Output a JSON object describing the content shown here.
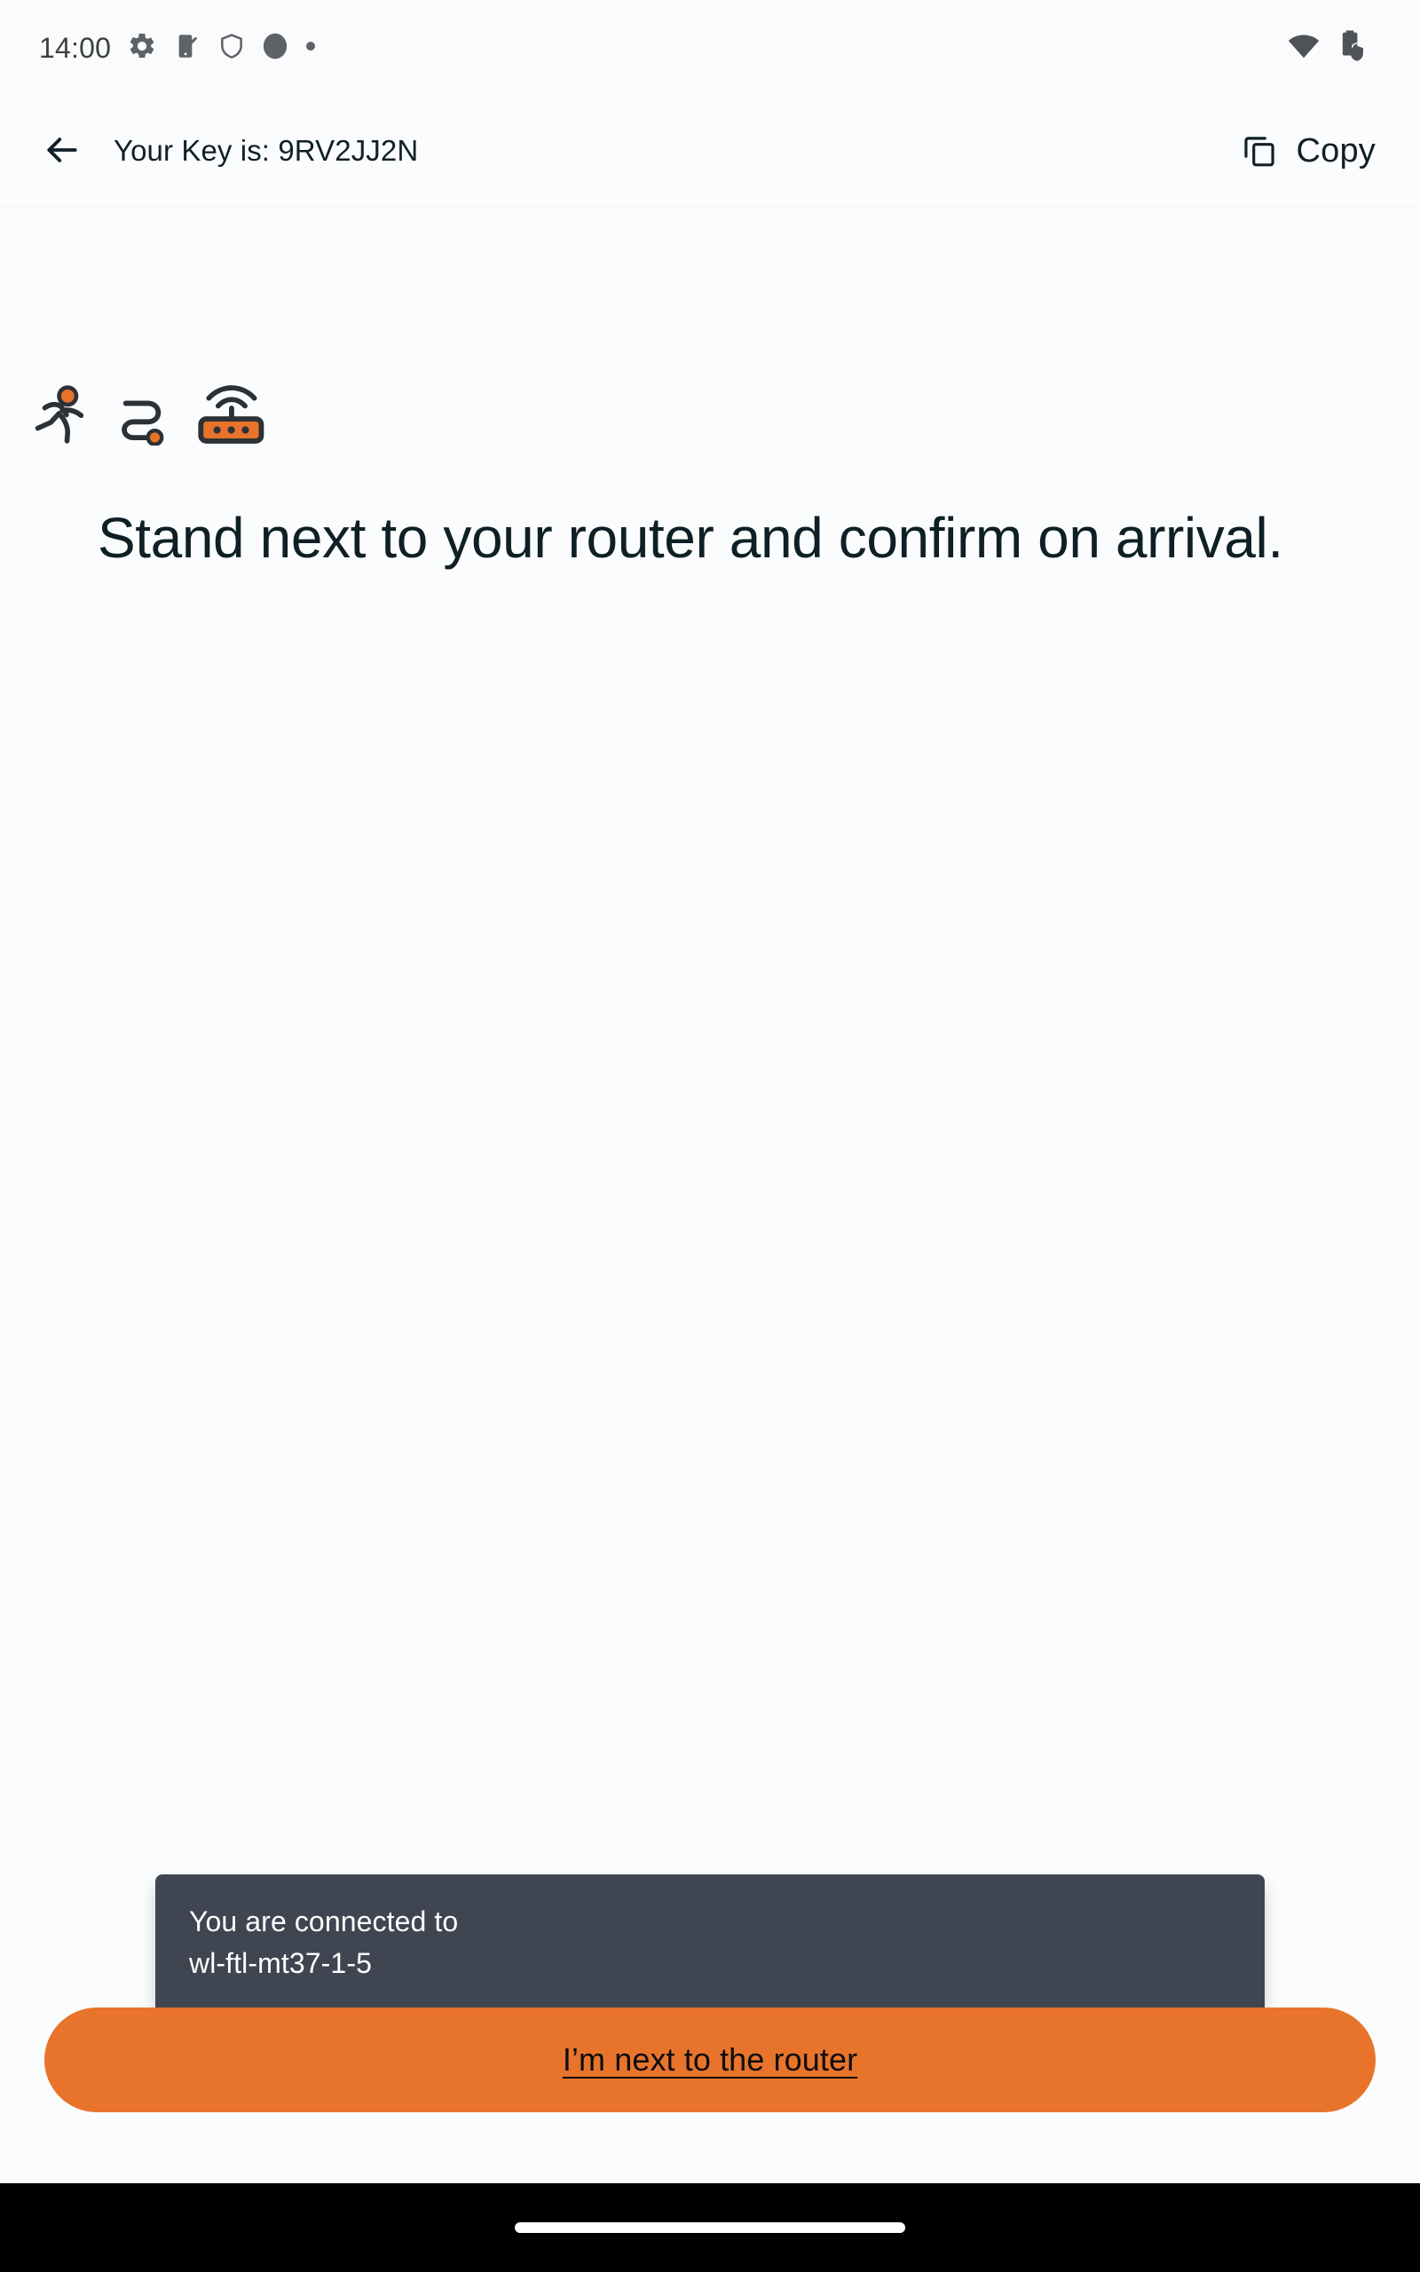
{
  "status_bar": {
    "time": "14:00",
    "left_icons": [
      "gear-icon",
      "phone-check-icon",
      "shield-icon",
      "circle-icon",
      "dot-icon"
    ],
    "right_icons": [
      "wifi-icon",
      "battery-shield-icon"
    ]
  },
  "app_bar": {
    "back_icon": "back-arrow-icon",
    "title": "Your Key is: 9RV2JJ2N",
    "copy_label": "Copy",
    "copy_icon": "copy-icon"
  },
  "main": {
    "step_icons": [
      "running-person-icon",
      "route-path-icon",
      "router-icon"
    ],
    "headline": "Stand next to your router and confirm on arrival."
  },
  "snackbar": {
    "line1": "You are connected to",
    "line2": "wl-ftl-mt37-1-5"
  },
  "primary_button": {
    "label": "I’m next to the router"
  },
  "colors": {
    "accent_orange": "#E8742C",
    "heading_dark": "#0E2025",
    "snackbar_bg": "#3F4651",
    "page_bg": "#FBFCFD",
    "nav_bar_bg": "#000000",
    "icon_outline": "#2C3136"
  }
}
